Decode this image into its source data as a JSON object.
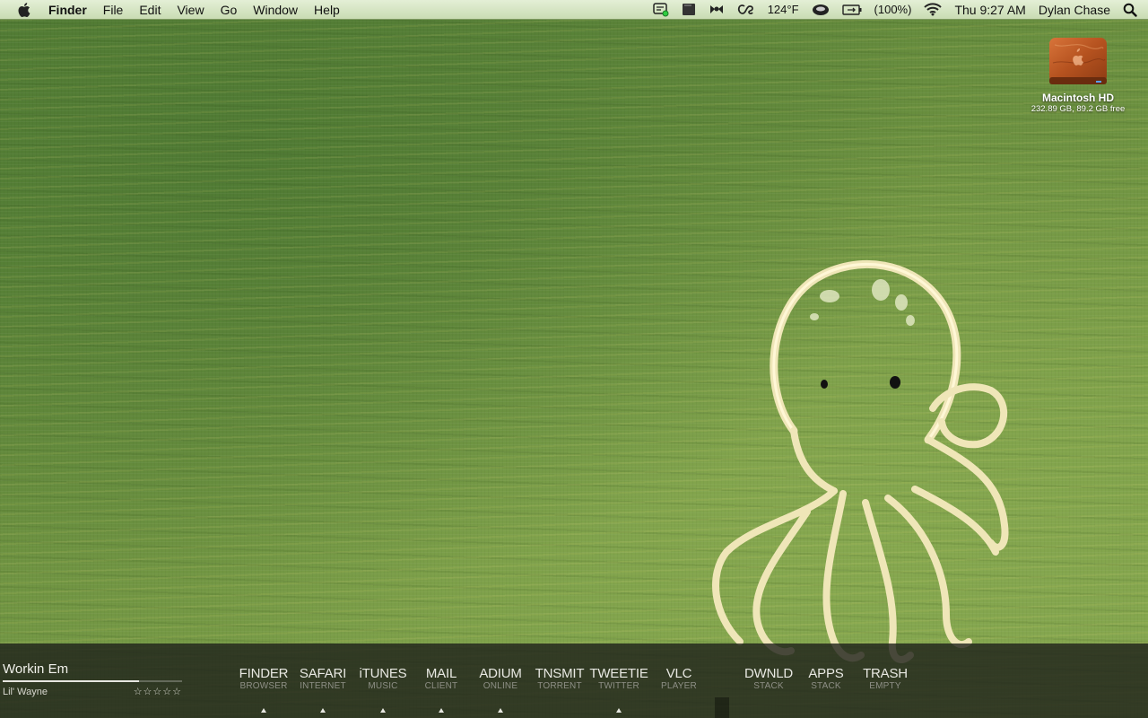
{
  "menubar": {
    "app_name": "Finder",
    "menus": [
      "File",
      "Edit",
      "View",
      "Go",
      "Window",
      "Help"
    ],
    "status": {
      "temperature": "124°F",
      "battery": "(100%)",
      "clock": "Thu 9:27 AM",
      "user": "Dylan Chase"
    }
  },
  "desktop": {
    "hd_icon": {
      "name": "Macintosh HD",
      "info": "232.89 GB, 89.2 GB free"
    }
  },
  "dock": {
    "items": [
      {
        "label": "FINDER",
        "sub": "BROWSER",
        "running": true
      },
      {
        "label": "SAFARI",
        "sub": "INTERNET",
        "running": true
      },
      {
        "label": "iTUNES",
        "sub": "MUSIC",
        "running": true
      },
      {
        "label": "MAIL",
        "sub": "CLIENT",
        "running": true
      },
      {
        "label": "ADIUM",
        "sub": "ONLINE",
        "running": true
      },
      {
        "label": "TNSMIT",
        "sub": "TORRENT",
        "running": false
      },
      {
        "label": "TWEETIE",
        "sub": "TWITTER",
        "running": true
      },
      {
        "label": "VLC",
        "sub": "PLAYER",
        "running": false
      },
      {
        "label": "DWNLD",
        "sub": "STACK",
        "running": false
      },
      {
        "label": "APPS",
        "sub": "STACK",
        "running": false
      },
      {
        "label": "TRASH",
        "sub": "EMPTY",
        "running": false
      }
    ]
  },
  "now_playing": {
    "track": "Workin Em",
    "artist": "Lil' Wayne",
    "progress": 0.76,
    "rating_stars": "☆☆☆☆☆"
  },
  "colors": {
    "wallpaper": "#6a8f3f",
    "menubar": "#d6e6c4",
    "dock_bg": "#1e201a",
    "dock_label": "#e8e8e2",
    "dock_sub": "#8e8f86"
  }
}
